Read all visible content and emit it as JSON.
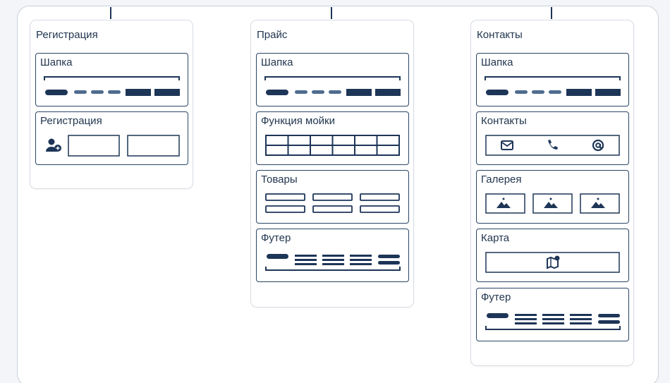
{
  "colors": {
    "ink": "#1d3557",
    "muted": "#4f6c8f",
    "border": "#2b4566"
  },
  "pages": [
    {
      "title": "Регистрация",
      "blocks": [
        {
          "label": "Шапка",
          "icon": "header-wireframe-icon"
        },
        {
          "label": "Регистрация",
          "icon": "add-user-form-icon"
        }
      ]
    },
    {
      "title": "Прайс",
      "blocks": [
        {
          "label": "Шапка",
          "icon": "header-wireframe-icon"
        },
        {
          "label": "Функция мойки",
          "icon": "table-grid-icon"
        },
        {
          "label": "Товары",
          "icon": "product-cards-icon"
        },
        {
          "label": "Футер",
          "icon": "footer-wireframe-icon"
        }
      ]
    },
    {
      "title": "Контакты",
      "blocks": [
        {
          "label": "Шапка",
          "icon": "header-wireframe-icon"
        },
        {
          "label": "Контакты",
          "icon": "contact-icons-row-icon"
        },
        {
          "label": "Галерея",
          "icon": "gallery-images-icon"
        },
        {
          "label": "Карта",
          "icon": "map-icon"
        },
        {
          "label": "Футер",
          "icon": "footer-wireframe-icon"
        }
      ]
    }
  ]
}
